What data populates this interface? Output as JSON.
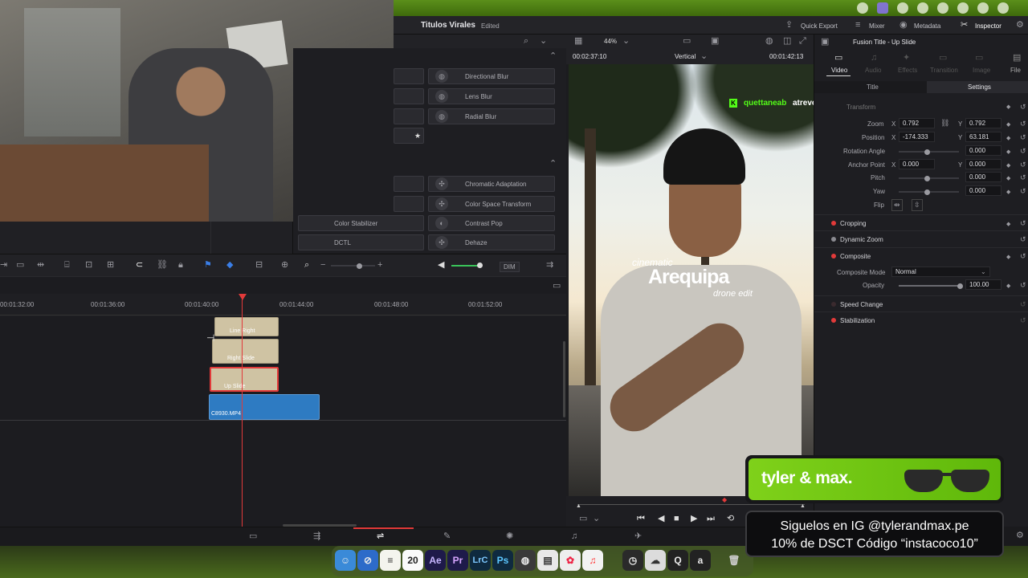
{
  "topbar": {
    "project": "Titulos Virales",
    "status": "Edited",
    "quick_export": "Quick Export",
    "mixer": "Mixer",
    "metadata": "Metadata",
    "inspector": "Inspector"
  },
  "effects": {
    "items_right": [
      "Directional Blur",
      "Lens Blur",
      "Radial Blur",
      "Chromatic Adaptation",
      "Color Space Transform",
      "Contrast Pop",
      "Dehaze"
    ],
    "items_left": [
      "Color Stabilizer",
      "DCTL"
    ]
  },
  "timeline": {
    "ruler": [
      "00:01:32:00",
      "00:01:36:00",
      "00:01:40:00",
      "00:01:44:00",
      "00:01:48:00",
      "00:01:52:00"
    ],
    "dim": "DIM",
    "clips": [
      {
        "label": "Line Right",
        "type": "title"
      },
      {
        "label": "Right Slide",
        "type": "title"
      },
      {
        "label": "Up Slide",
        "type": "title-selected"
      },
      {
        "label": "C8930.MP4",
        "type": "video"
      }
    ]
  },
  "viewer": {
    "zoom": "44%",
    "timecode_left": "00:02:37:10",
    "mode": "Vertical",
    "timecode_right": "00:01:42:13",
    "chat_user": "quettaneab",
    "chat_msg": "atrevete ps, súbelo en one",
    "title_small": "cinematic",
    "title_big": "Arequipa",
    "title_sub": "drone edit"
  },
  "inspector": {
    "header": "Fusion Title - Up Slide",
    "tabs": [
      "Video",
      "Audio",
      "Effects",
      "Transition",
      "Image",
      "File"
    ],
    "subtabs": [
      "Title",
      "Settings"
    ],
    "transform_label": "Transform",
    "rows": {
      "zoom": {
        "label": "Zoom",
        "x": "0.792",
        "y": "0.792"
      },
      "position": {
        "label": "Position",
        "x": "-174.333",
        "y": "63.181"
      },
      "rotation": {
        "label": "Rotation Angle",
        "value": "0.000"
      },
      "anchor": {
        "label": "Anchor Point",
        "x": "0.000",
        "y": "0.000"
      },
      "pitch": {
        "label": "Pitch",
        "value": "0.000"
      },
      "yaw": {
        "label": "Yaw",
        "value": "0.000"
      },
      "flip": {
        "label": "Flip"
      }
    },
    "axis_x": "X",
    "axis_y": "Y",
    "sections": [
      "Cropping",
      "Dynamic Zoom",
      "Composite",
      "Speed Change",
      "Stabilization"
    ],
    "composite_mode_label": "Composite Mode",
    "composite_mode_value": "Normal",
    "opacity_label": "Opacity",
    "opacity_value": "100.00"
  },
  "ads": {
    "brand": "tyler & max.",
    "line1": "Siguelos en IG @tylerandmax.pe",
    "line2": "10% de DSCT Código “instacoco10”"
  },
  "dock": {
    "items": [
      "Finder",
      "Safari",
      "Notes",
      "20",
      "Ae",
      "Pr",
      "LrC",
      "Ps",
      "Resolve",
      "Preview",
      "Photos",
      "Music",
      "Clock",
      "Cloud",
      "Q",
      "a",
      "Trash"
    ]
  },
  "colors": {
    "accent_red": "#e23a3a",
    "title_clip": "#cfc3a3",
    "video_clip": "#2e7bc2",
    "macbar_green": "#4a7a12"
  }
}
